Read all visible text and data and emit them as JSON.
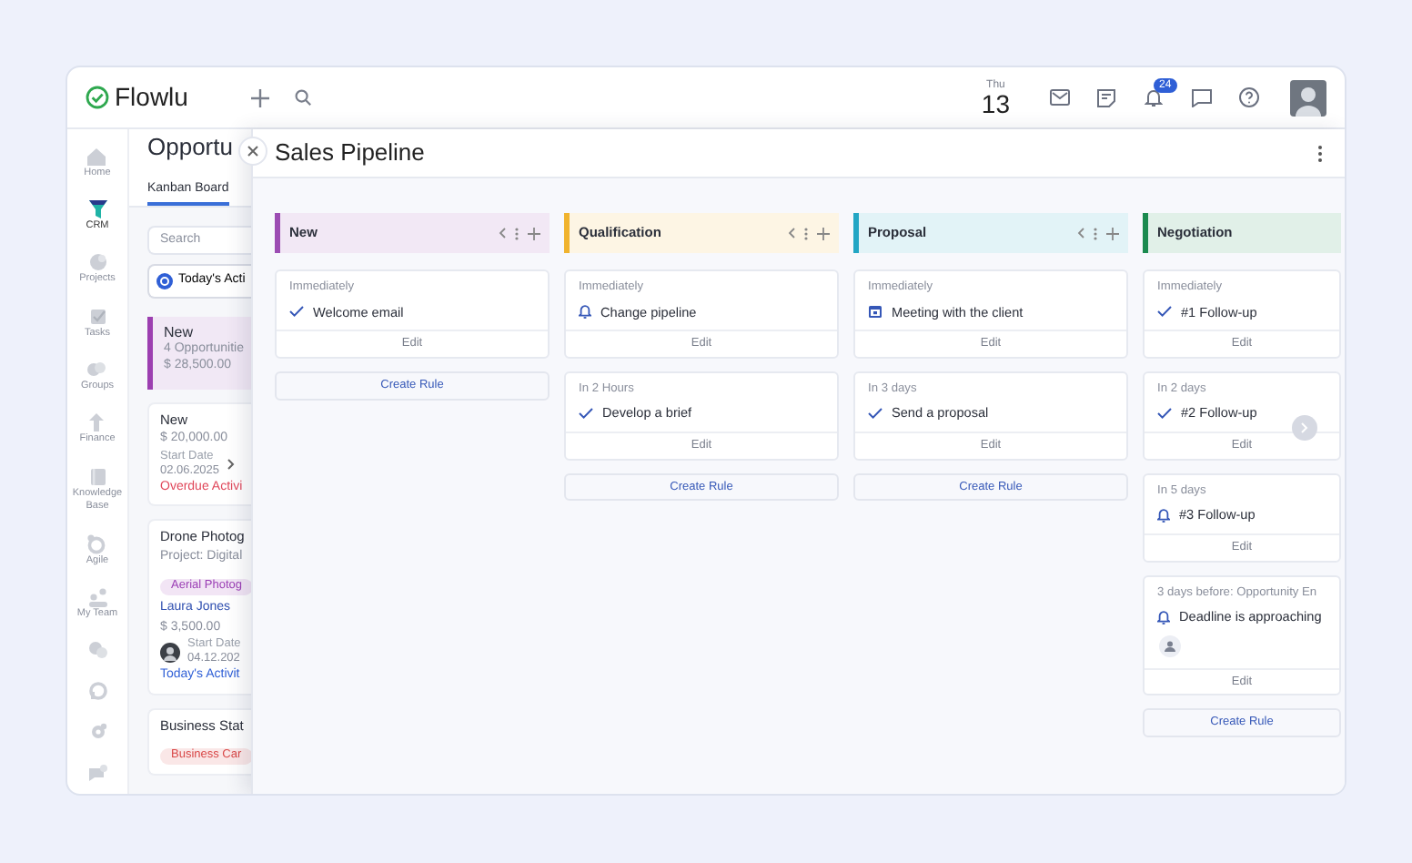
{
  "topbar": {
    "logo": "Flowlu",
    "weekday": "Thu",
    "day": "13",
    "notification_count": "24"
  },
  "sidebar": {
    "items": [
      {
        "label": "Home",
        "selected": false
      },
      {
        "label": "CRM",
        "selected": true
      },
      {
        "label": "Projects",
        "selected": false
      },
      {
        "label": "Tasks",
        "selected": false
      },
      {
        "label": "Groups",
        "selected": false
      },
      {
        "label": "Finance",
        "selected": false
      },
      {
        "label": "Knowledge Base",
        "selected": false
      },
      {
        "label": "Agile",
        "selected": false
      },
      {
        "label": "My Team",
        "selected": false
      },
      {
        "selected": false
      },
      {
        "selected": false
      },
      {
        "selected": false
      },
      {
        "selected": false
      }
    ]
  },
  "opportunities": {
    "title": "Opportu",
    "tabs": [
      {
        "label": "Kanban Board",
        "selected": true
      }
    ],
    "search": {
      "placeholder": "Search"
    },
    "filter": "Today's Acti",
    "stage": {
      "title": "New",
      "count": "4 Opportunitie",
      "amount": "$ 28,500.00",
      "color": "#9c3fb0"
    },
    "cards": [
      {
        "title": "New",
        "amount": "$ 20,000.00",
        "date_label": "Start Date",
        "date": "02.06.2025",
        "chevron": true,
        "avatar": false,
        "activity": "Overdue Activi",
        "overdue": true
      },
      {
        "title": "Drone Photog",
        "project": "Project: Digital",
        "tag": {
          "label": "Aerial Photog",
          "color": "#9b3fb5"
        },
        "contact": "Laura Jones",
        "amount": "$ 3,500.00",
        "date_label": "Start Date",
        "date": "04.12.202",
        "chevron": false,
        "avatar": true,
        "activity": "Today's Activit",
        "overdue": false
      },
      {
        "title": "Business Stat",
        "tag": {
          "label": "Business Car",
          "color": "#d94848"
        }
      }
    ]
  },
  "pipeline": {
    "title": "Sales Pipeline",
    "columns": [
      {
        "title": "New",
        "color": "#9c4db3",
        "controls": true,
        "create_rule": "Create Rule",
        "rules": [
          {
            "trigger": "Immediately",
            "kind": "task",
            "action": "Welcome email",
            "assignee": false,
            "edit": "Edit"
          }
        ]
      },
      {
        "title": "Qualification",
        "color": "#f0b32e",
        "controls": true,
        "create_rule": "Create Rule",
        "rules": [
          {
            "trigger": "Immediately",
            "kind": "notification",
            "action": "Change pipeline",
            "assignee": false,
            "edit": "Edit"
          },
          {
            "trigger": "In 2 Hours",
            "kind": "task",
            "action": "Develop a brief",
            "assignee": false,
            "edit": "Edit"
          }
        ]
      },
      {
        "title": "Proposal",
        "color": "#23a6c4",
        "controls": true,
        "create_rule": "Create Rule",
        "rules": [
          {
            "trigger": "Immediately",
            "kind": "event",
            "action": "Meeting with the client",
            "assignee": false,
            "edit": "Edit"
          },
          {
            "trigger": "In 3 days",
            "kind": "task",
            "action": "Send a proposal",
            "assignee": false,
            "edit": "Edit"
          }
        ]
      },
      {
        "title": "Negotiation",
        "color": "#1b8a4f",
        "controls": false,
        "create_rule": "Create Rule",
        "rules": [
          {
            "trigger": "Immediately",
            "kind": "task",
            "action": "#1 Follow-up",
            "assignee": false,
            "edit": "Edit"
          },
          {
            "trigger": "In 2 days",
            "kind": "task",
            "action": "#2 Follow-up",
            "assignee": false,
            "edit": "Edit"
          },
          {
            "trigger": "In 5 days",
            "kind": "notification",
            "action": "#3 Follow-up",
            "assignee": false,
            "edit": "Edit"
          },
          {
            "trigger": "3 days before: Opportunity En",
            "kind": "notification",
            "action": "Deadline is approaching",
            "assignee": true,
            "edit": "Edit"
          }
        ]
      }
    ]
  }
}
